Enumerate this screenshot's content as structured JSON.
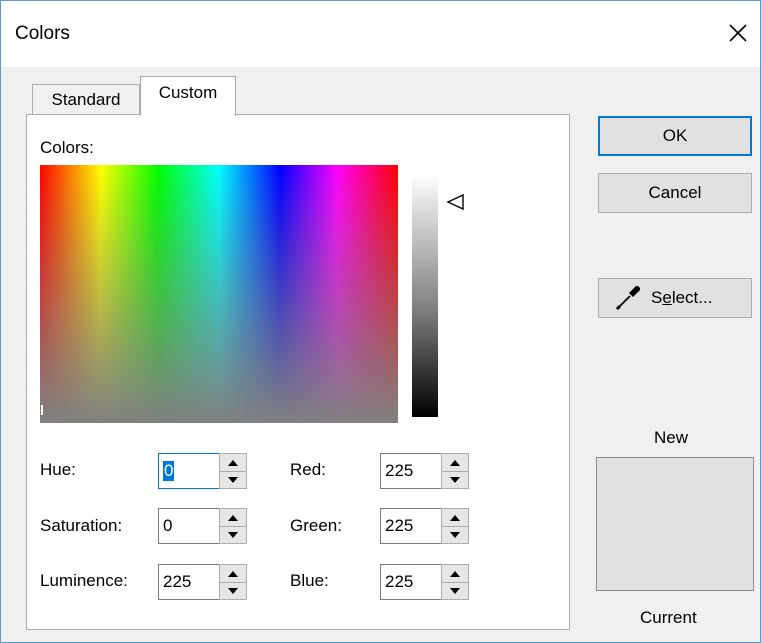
{
  "window": {
    "title": "Colors"
  },
  "tabs": [
    {
      "label": "Standard"
    },
    {
      "label": "Custom"
    }
  ],
  "custom": {
    "colors_label": "Colors:",
    "fields": {
      "hue": {
        "label": "Hue:",
        "value": "0"
      },
      "saturation": {
        "label": "Saturation:",
        "value": "0"
      },
      "luminence": {
        "label": "Luminence:",
        "value": "225"
      },
      "red": {
        "label": "Red:",
        "value": "225"
      },
      "green": {
        "label": "Green:",
        "value": "225"
      },
      "blue": {
        "label": "Blue:",
        "value": "225"
      }
    }
  },
  "buttons": {
    "ok": "OK",
    "cancel": "Cancel",
    "select_prefix": "S",
    "select_mnemonic": "e",
    "select_suffix": "lect..."
  },
  "preview": {
    "new_label": "New",
    "current_label": "Current",
    "color": "#e1e1e1"
  },
  "icons": [
    "close-icon",
    "eyedropper-icon",
    "luminance-pointer-icon",
    "spin-up-icon",
    "spin-down-icon"
  ]
}
